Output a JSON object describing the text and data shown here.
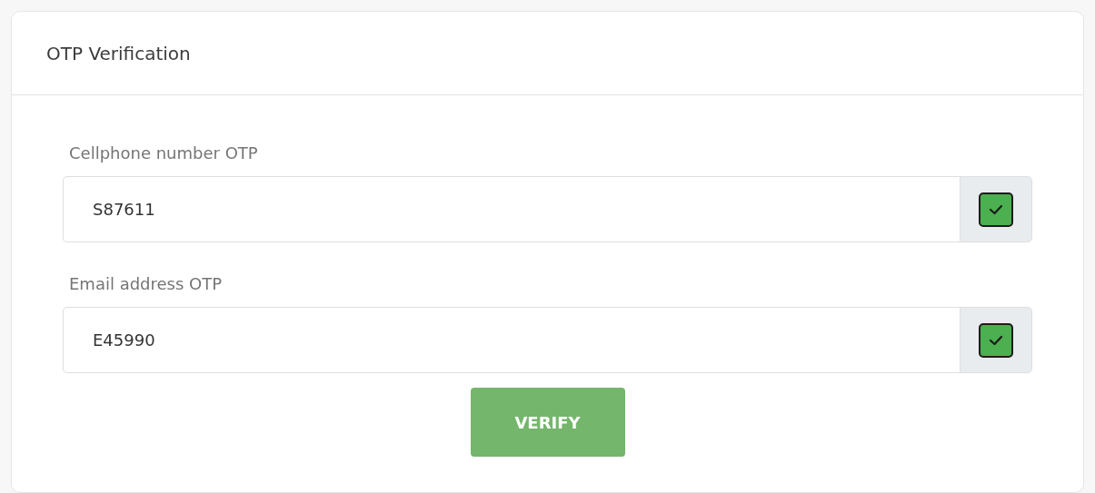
{
  "card": {
    "title": "OTP Verification"
  },
  "fields": [
    {
      "label": "Cellphone number OTP",
      "value": "S87611",
      "checked": true
    },
    {
      "label": "Email address OTP",
      "value": "E45990",
      "checked": true
    }
  ],
  "button": {
    "label": "VERIFY"
  }
}
